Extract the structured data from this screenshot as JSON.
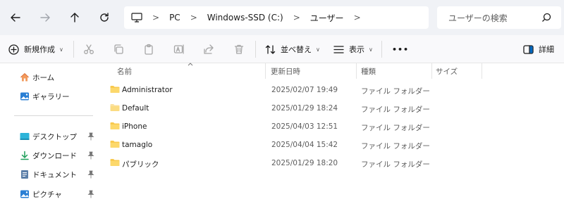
{
  "nav": {
    "back_icon": "arrow-left-icon",
    "forward_icon": "arrow-right-icon",
    "up_icon": "arrow-up-icon",
    "refresh_icon": "refresh-icon"
  },
  "address": {
    "crumbs": [
      "PC",
      "Windows-SSD (C:)",
      "ユーザー"
    ]
  },
  "search": {
    "placeholder": "ユーザーの検索"
  },
  "toolbar": {
    "new_label": "新規作成",
    "sort_label": "並べ替え",
    "view_label": "表示",
    "more_label": "•••",
    "details_label": "詳細"
  },
  "sidebar": {
    "items": [
      {
        "label": "ホーム",
        "icon": "home-icon",
        "pinned": false
      },
      {
        "label": "ギャラリー",
        "icon": "gallery-icon",
        "pinned": false
      },
      {
        "label": "デスクトップ",
        "icon": "desktop-icon",
        "pinned": true
      },
      {
        "label": "ダウンロード",
        "icon": "download-icon",
        "pinned": true
      },
      {
        "label": "ドキュメント",
        "icon": "document-icon",
        "pinned": true
      },
      {
        "label": "ピクチャ",
        "icon": "pictures-icon",
        "pinned": true
      }
    ]
  },
  "columns": {
    "name": "名前",
    "modified": "更新日時",
    "type": "種類",
    "size": "サイズ"
  },
  "files": [
    {
      "name": "Administrator",
      "modified": "2025/02/07 19:49",
      "type": "ファイル フォルダー"
    },
    {
      "name": "Default",
      "modified": "2025/01/29 18:24",
      "type": "ファイル フォルダー"
    },
    {
      "name": "iPhone",
      "modified": "2025/04/03 12:51",
      "type": "ファイル フォルダー"
    },
    {
      "name": "tamaglo",
      "modified": "2025/04/04 15:42",
      "type": "ファイル フォルダー"
    },
    {
      "name": "パブリック",
      "modified": "2025/01/29 18:20",
      "type": "ファイル フォルダー"
    }
  ],
  "colors": {
    "folder": "#f8c94d",
    "accent": "#0067c0"
  }
}
